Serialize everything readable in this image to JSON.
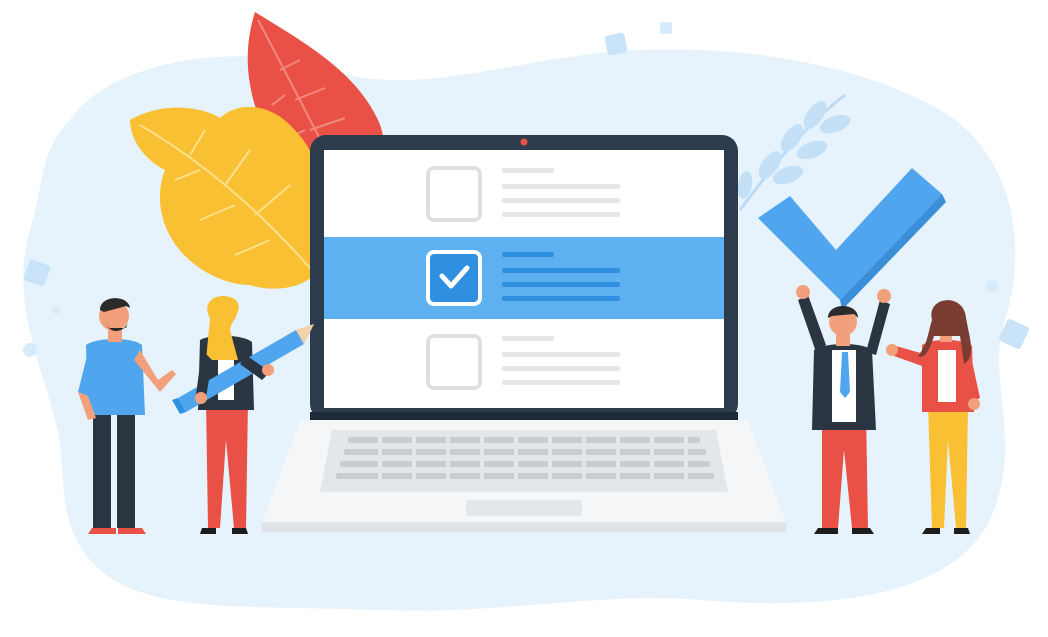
{
  "illustration": {
    "subject": "checklist-on-laptop-with-people",
    "checklist": {
      "items": [
        {
          "checked": false,
          "highlighted": false
        },
        {
          "checked": true,
          "highlighted": true
        },
        {
          "checked": false,
          "highlighted": false
        }
      ]
    },
    "icons": [
      "checkmark-icon",
      "pencil-icon",
      "leaf-icon",
      "laptop-icon"
    ],
    "colors": {
      "background_blob": "#e4f2fc",
      "accent_blue": "#4fa6ee",
      "highlight_row": "#5db1f0",
      "laptop_frame": "#2c3c4c",
      "leaf_yellow": "#f8c032",
      "leaf_red": "#ea5146",
      "skin": "#f2a07c"
    }
  }
}
